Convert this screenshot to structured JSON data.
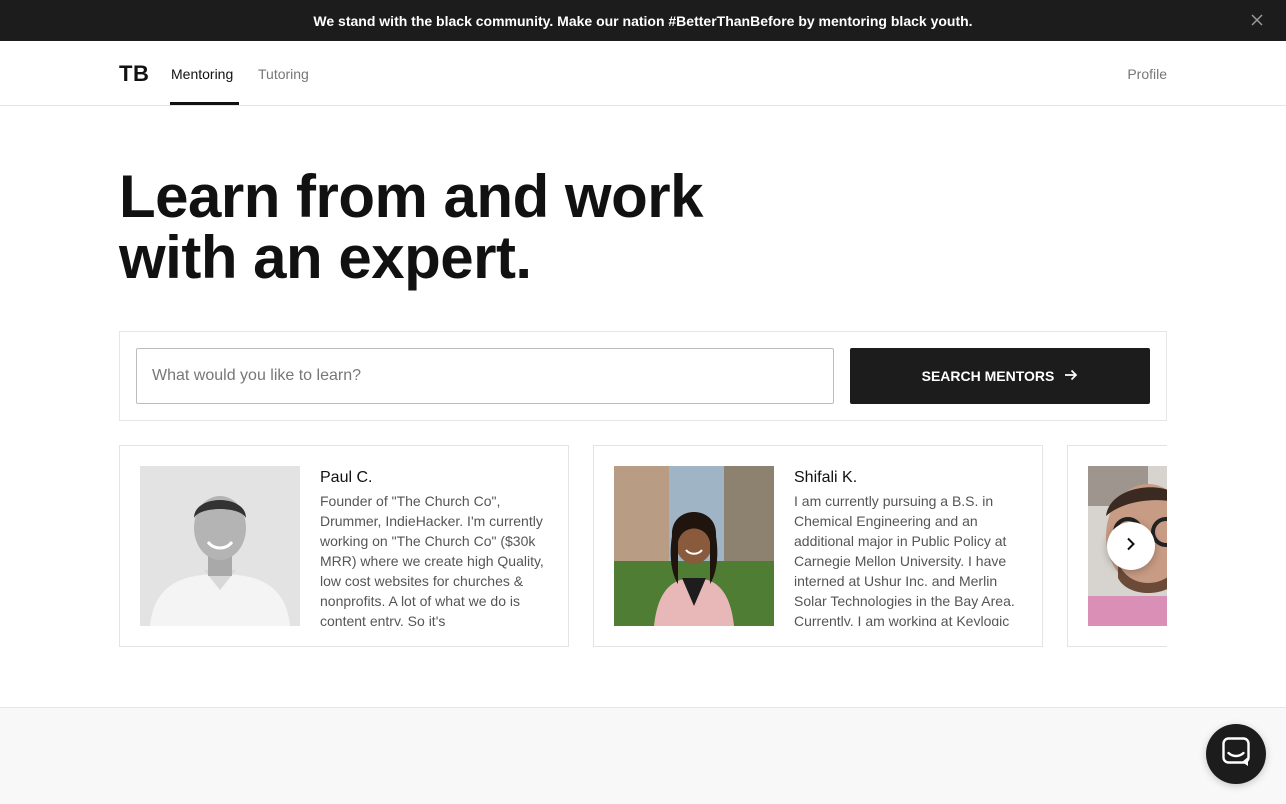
{
  "banner": {
    "text": "We stand with the black community. Make our nation #BetterThanBefore by mentoring black youth.",
    "close_icon": "close-icon"
  },
  "nav": {
    "logo": "TB",
    "tabs": [
      {
        "label": "Mentoring",
        "active": true
      },
      {
        "label": "Tutoring",
        "active": false
      }
    ],
    "profile_label": "Profile"
  },
  "hero": {
    "line1": "Learn from and work",
    "line2": "with an expert."
  },
  "search": {
    "placeholder": "What would you like to learn?",
    "value": "",
    "button_label": "SEARCH MENTORS",
    "button_icon": "arrow-right-icon"
  },
  "mentors": [
    {
      "name": "Paul C.",
      "bio": "Founder of \"The Church Co\", Drummer, IndieHacker. I'm currently working on \"The Church Co\" ($30k MRR) where we create high Quality, low cost websites for churches & nonprofits. A lot of what we do is content entry. So it's"
    },
    {
      "name": "Shifali K.",
      "bio": "I am currently pursuing a B.S. in Chemical Engineering and an additional major in Public Policy at Carnegie Mellon University. I have interned at Ushur Inc. and Merlin Solar Technologies in the Bay Area. Currently, I am working at Keylogic"
    },
    {
      "name": "",
      "bio": ""
    }
  ],
  "carousel": {
    "next_icon": "chevron-right-icon"
  },
  "chat": {
    "icon": "chat-icon"
  },
  "colors": {
    "dark": "#1c1c1c",
    "muted_text": "#777777",
    "border": "#e4e4e4"
  }
}
